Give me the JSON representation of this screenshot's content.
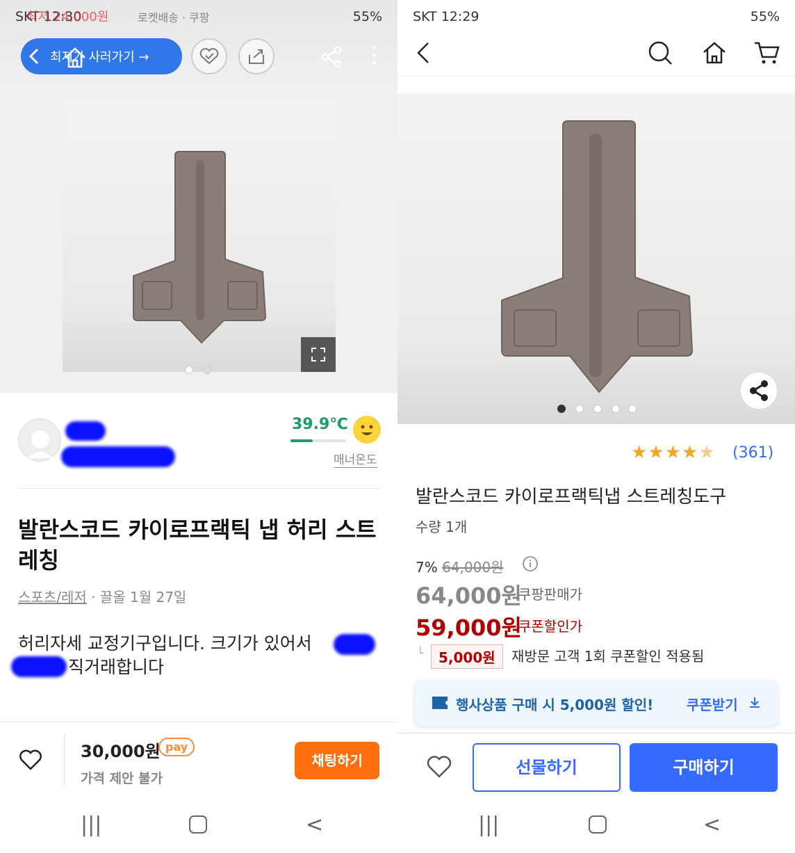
{
  "left": {
    "status_time": "SKT 12:30",
    "status_right": "55%",
    "status_overlay": "최저 24,000원",
    "status_overlay2": "로켓배송 · 쿠팡",
    "back_pill_label": "최저가 사러가기 →",
    "temperature": "39.9℃",
    "manner_label": "매너온도",
    "title": "발란스코드 카이로프랙틱 냅 허리 스트레칭",
    "category": "스포츠/레저",
    "meta": "· 끌올 1월 27일",
    "description_1": "허리자세 교정기구입니다. 크기가 있어서",
    "description_2": "직거래합니다",
    "price": "30,000원",
    "pay_badge": "pay",
    "price_note": "가격 제안 불가",
    "chat_button": "채팅하기"
  },
  "right": {
    "status_time": "SKT 12:29",
    "status_right": "55%",
    "rating_count": "(361)",
    "title": "발란스코드 카이로프랙틱냅 스트레칭도구",
    "quantity": "수량 1개",
    "discount_pct": "7%",
    "original_price": "64,000원",
    "sale_price": "64,000원",
    "sale_label": "쿠팡판매가",
    "coupon_price": "59,000원",
    "coupon_label": "쿠폰할인가",
    "coupon_amount": "5,000원",
    "coupon_desc": "재방문 고객 1회 쿠폰할인 적용됨",
    "promo_text": "행사상품 구매 시 5,000원 할인!",
    "promo_button": "쿠폰받기",
    "gift_button": "선물하기",
    "buy_button": "구매하기"
  },
  "colors": {
    "orange": "#ff6f0f",
    "coupang_red": "#ae0000",
    "coupang_blue": "#346aff",
    "green_temp": "#1a9c6b"
  },
  "icons": [
    "back-icon",
    "home-icon",
    "heart-icon",
    "share-icon",
    "search-icon",
    "cart-icon",
    "more-icon",
    "expand-icon",
    "info-icon",
    "star-icon"
  ],
  "slider_left": {
    "count": 2,
    "active": 0
  },
  "slider_right": {
    "count": 5,
    "active": 0
  },
  "rating_value": 4.5
}
